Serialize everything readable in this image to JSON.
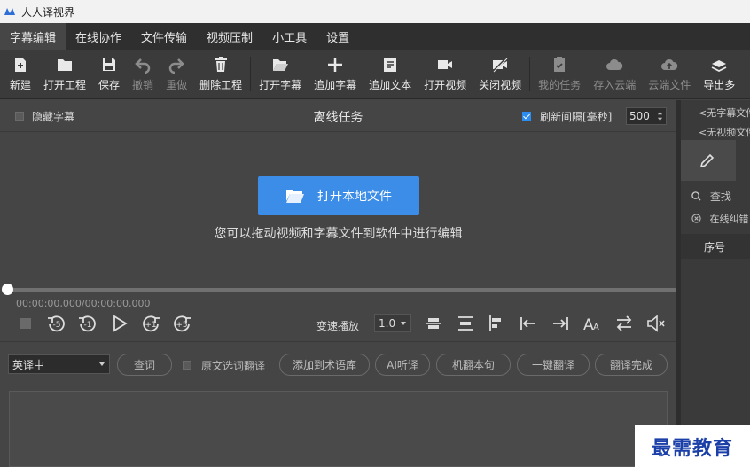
{
  "app": {
    "title": "人人译视界"
  },
  "menu": [
    {
      "label": "字幕编辑",
      "active": true
    },
    {
      "label": "在线协作"
    },
    {
      "label": "文件传输"
    },
    {
      "label": "视频压制"
    },
    {
      "label": "小工具"
    },
    {
      "label": "设置"
    }
  ],
  "toolbar": {
    "new": "新建",
    "open_project": "打开工程",
    "save": "保存",
    "undo": "撤销",
    "redo": "重做",
    "delete_project": "删除工程",
    "open_subtitle": "打开字幕",
    "add_subtitle": "追加字幕",
    "add_text": "追加文本",
    "open_video": "打开视频",
    "close_video": "关闭视频",
    "my_tasks": "我的任务",
    "save_cloud": "存入云端",
    "cloud_files": "云端文件",
    "export": "导出多"
  },
  "task_header": {
    "hide_subtitle": "隐藏字幕",
    "title": "离线任务",
    "refresh_label": "刷新间隔[毫秒]",
    "refresh_value": "500"
  },
  "video": {
    "open_local": "打开本地文件",
    "drag_hint": "您可以拖动视频和字幕文件到软件中进行编辑",
    "time": "00:00:00,000/00:00:00,000",
    "progress": 0
  },
  "playback": {
    "speed_label": "变速播放",
    "speed_value": "1.0"
  },
  "translate": {
    "language": "英译中",
    "lookup": "查词",
    "source_check": "原文选词翻译",
    "add_term": "添加到术语库",
    "ai_listen": "AI听译",
    "machine_sentence": "机翻本句",
    "one_click": "一键翻译",
    "done": "翻译完成"
  },
  "right_panel": {
    "no_subtitle": "<无字幕文件",
    "no_video": "<无视频文件",
    "search": "查找",
    "online_check": "在线纠错",
    "seq": "序号"
  },
  "watermark": "最需教育"
}
